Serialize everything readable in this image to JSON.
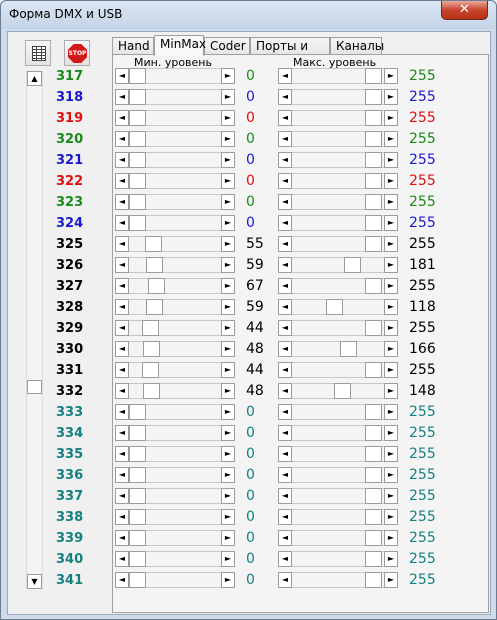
{
  "window": {
    "title": "Форма DMX и USB",
    "close_label": "✕"
  },
  "toolbar": {
    "grid_icon": "grid-icon",
    "stop_icon": "stop-icon",
    "stop_label": "STOP"
  },
  "scrollbar": {
    "up": "▲",
    "down": "▼",
    "position": 0.62
  },
  "tabs": [
    {
      "label": "Hand",
      "active": false
    },
    {
      "label": "MinMax",
      "active": true
    },
    {
      "label": "Coder",
      "active": false
    },
    {
      "label": "Порты и цвет",
      "active": false
    },
    {
      "label": "Каналы",
      "active": false
    }
  ],
  "headers": {
    "min": "Мин. уровень",
    "max": "Макс. уровень"
  },
  "colors": {
    "green": "#1a8a1a",
    "blue": "#1a1acc",
    "red": "#dd1111",
    "black": "#000000",
    "teal": "#158080"
  },
  "rows": [
    {
      "ch": "317",
      "color": "green",
      "min": "0",
      "max": "255"
    },
    {
      "ch": "318",
      "color": "blue",
      "min": "0",
      "max": "255"
    },
    {
      "ch": "319",
      "color": "red",
      "min": "0",
      "max": "255"
    },
    {
      "ch": "320",
      "color": "green",
      "min": "0",
      "max": "255"
    },
    {
      "ch": "321",
      "color": "blue",
      "min": "0",
      "max": "255"
    },
    {
      "ch": "322",
      "color": "red",
      "min": "0",
      "max": "255"
    },
    {
      "ch": "323",
      "color": "green",
      "min": "0",
      "max": "255"
    },
    {
      "ch": "324",
      "color": "blue",
      "min": "0",
      "max": "255"
    },
    {
      "ch": "325",
      "color": "black",
      "min": "55",
      "max": "255"
    },
    {
      "ch": "326",
      "color": "black",
      "min": "59",
      "max": "181"
    },
    {
      "ch": "327",
      "color": "black",
      "min": "67",
      "max": "255"
    },
    {
      "ch": "328",
      "color": "black",
      "min": "59",
      "max": "118"
    },
    {
      "ch": "329",
      "color": "black",
      "min": "44",
      "max": "255"
    },
    {
      "ch": "330",
      "color": "black",
      "min": "48",
      "max": "166"
    },
    {
      "ch": "331",
      "color": "black",
      "min": "44",
      "max": "255"
    },
    {
      "ch": "332",
      "color": "black",
      "min": "48",
      "max": "148"
    },
    {
      "ch": "333",
      "color": "teal",
      "min": "0",
      "max": "255"
    },
    {
      "ch": "334",
      "color": "teal",
      "min": "0",
      "max": "255"
    },
    {
      "ch": "335",
      "color": "teal",
      "min": "0",
      "max": "255"
    },
    {
      "ch": "336",
      "color": "teal",
      "min": "0",
      "max": "255"
    },
    {
      "ch": "337",
      "color": "teal",
      "min": "0",
      "max": "255"
    },
    {
      "ch": "338",
      "color": "teal",
      "min": "0",
      "max": "255"
    },
    {
      "ch": "339",
      "color": "teal",
      "min": "0",
      "max": "255"
    },
    {
      "ch": "340",
      "color": "teal",
      "min": "0",
      "max": "255"
    },
    {
      "ch": "341",
      "color": "teal",
      "min": "0",
      "max": "255"
    }
  ]
}
